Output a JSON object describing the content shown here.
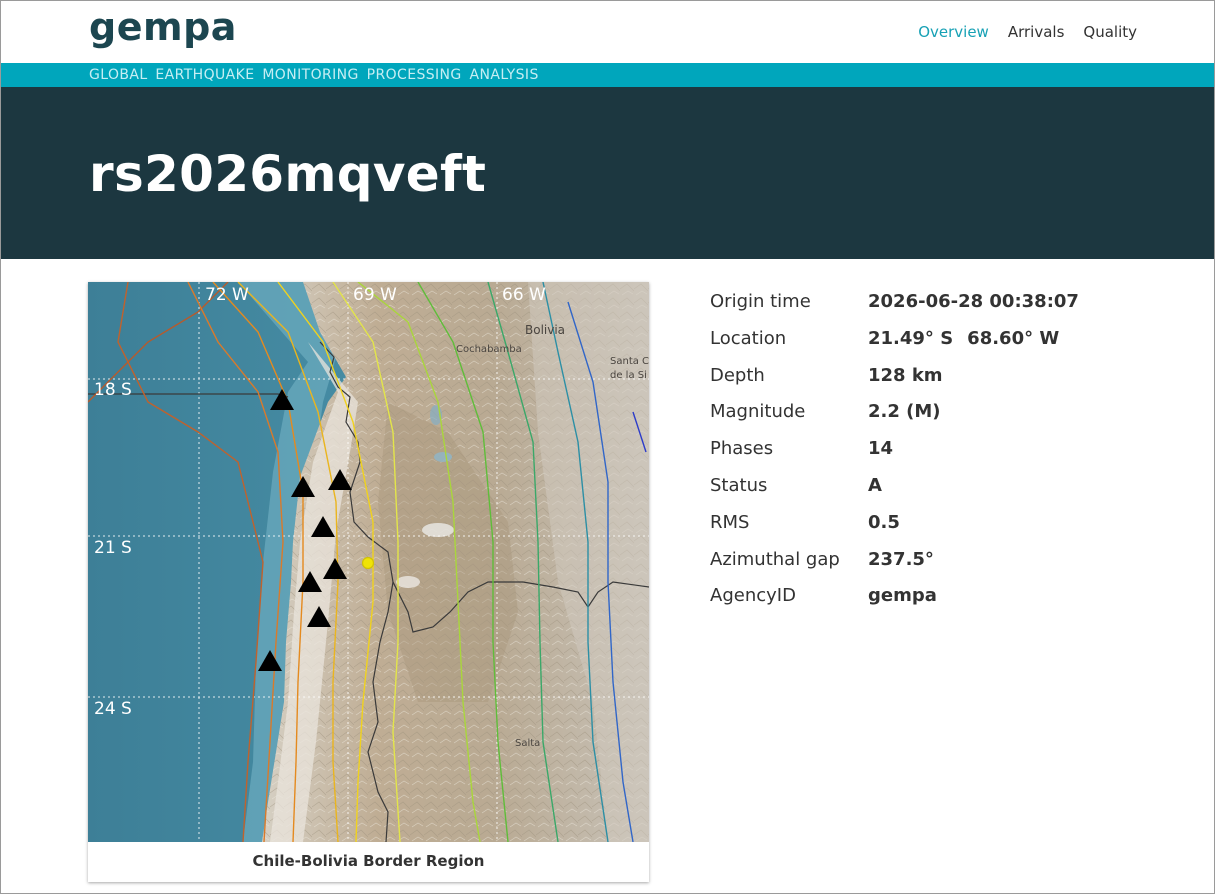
{
  "header": {
    "logo_text": "gempa",
    "nav": [
      {
        "label": "Overview",
        "active": true
      },
      {
        "label": "Arrivals",
        "active": false
      },
      {
        "label": "Quality",
        "active": false
      }
    ]
  },
  "tagline": "GLOBAL EARTHQUAKE MONITORING PROCESSING ANALYSIS",
  "event": {
    "id": "rs2026mqveft"
  },
  "map": {
    "caption": "Chile-Bolivia Border Region",
    "longitude_labels": [
      "72 W",
      "69 W",
      "66 W"
    ],
    "latitude_labels": [
      "18 S",
      "21 S",
      "24 S"
    ],
    "place_labels": [
      "Bolivia",
      "Cochabamba",
      "Santa C",
      "de la Si",
      "Salta"
    ],
    "epicenter_color": "#f2e600",
    "station_color": "#000000"
  },
  "details": [
    {
      "label": "Origin time",
      "value": "2026-06-28 00:38:07"
    },
    {
      "label": "Location",
      "value": "21.49° S",
      "value2": "68.60° W"
    },
    {
      "label": "Depth",
      "value": "128 km"
    },
    {
      "label": "Magnitude",
      "value": "2.2 (M)"
    },
    {
      "label": "Phases",
      "value": "14"
    },
    {
      "label": "Status",
      "value": "A"
    },
    {
      "label": "RMS",
      "value": "0.5"
    },
    {
      "label": "Azimuthal gap",
      "value": "237.5°"
    },
    {
      "label": "AgencyID",
      "value": "gempa"
    }
  ],
  "colors": {
    "brand_dark": "#1c3740",
    "brand_teal": "#00a6bc",
    "nav_active": "#17a1b5"
  }
}
